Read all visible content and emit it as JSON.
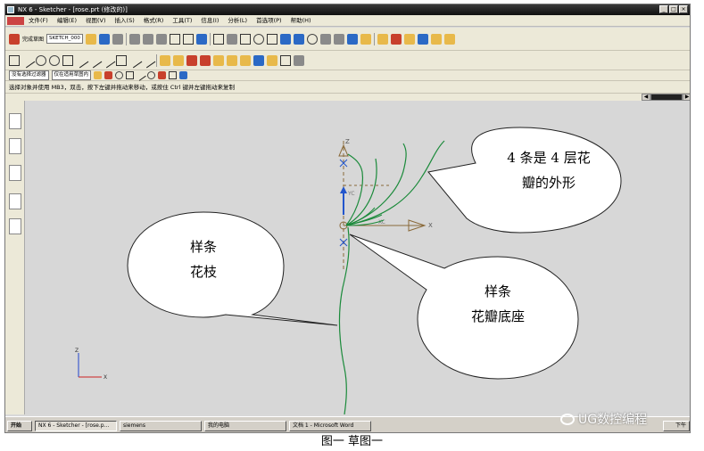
{
  "window": {
    "title": "NX 6 - Sketcher - [rose.prt (修改的)]",
    "controls": [
      "_",
      "□",
      "×"
    ]
  },
  "menu": [
    "文件(F)",
    "编辑(E)",
    "视图(V)",
    "插入(S)",
    "格式(R)",
    "工具(T)",
    "信息(I)",
    "分析(L)",
    "首选项(P)",
    "帮助(H)"
  ],
  "toolbar": {
    "finish_label": "完成草图",
    "sketch_name": "SKETCH_000",
    "filter_select": "没有选择过滤器",
    "scope_select": "仅在适用草图内"
  },
  "status_hint": "选择对象并使用 MB3，双击，按下左键并拖动来移动，或按住 Ctrl 键并左键拖动来复制",
  "sketch": {
    "axis_z": "Z",
    "axis_x": "X",
    "axis_yc": "YC",
    "axis_xc": "XC",
    "triad_z": "Z",
    "triad_x": "X"
  },
  "callouts": {
    "petals": [
      "4 条是 4 层花",
      "瓣的外形"
    ],
    "stem": [
      "样条",
      "花枝"
    ],
    "base": [
      "样条",
      "花瓣底座"
    ]
  },
  "taskbar": {
    "start": "开始",
    "tasks": [
      "NX 6 - Sketcher - [rose.p...",
      "siemens",
      "我的电脑",
      "文档 1 - Microsoft Word"
    ],
    "clock": "下午"
  },
  "watermark": "UG数控编程",
  "caption": "图一  草图一",
  "colors": {
    "spline": "#1a8a3a",
    "callout_fill": "#ffffff",
    "canvas": "#d7d7d7"
  }
}
